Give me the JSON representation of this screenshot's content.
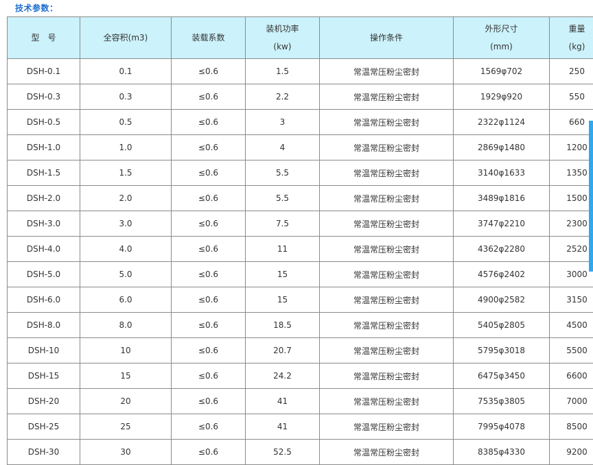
{
  "section_title": "技术参数：",
  "columns": [
    {
      "line1": "型　号",
      "line2": ""
    },
    {
      "line1": "全容积(m3)",
      "line2": ""
    },
    {
      "line1": "装载系数",
      "line2": ""
    },
    {
      "line1": "装机功率",
      "line2": "(kw)"
    },
    {
      "line1": "操作条件",
      "line2": ""
    },
    {
      "line1": "外形尺寸",
      "line2": "(mm)"
    },
    {
      "line1": "重量",
      "line2": "(kg)"
    }
  ],
  "rows": [
    [
      "DSH-0.1",
      "0.1",
      "≤0.6",
      "1.5",
      "常温常压粉尘密封",
      "1569φ702",
      "250"
    ],
    [
      "DSH-0.3",
      "0.3",
      "≤0.6",
      "2.2",
      "常温常压粉尘密封",
      "1929φ920",
      "550"
    ],
    [
      "DSH-0.5",
      "0.5",
      "≤0.6",
      "3",
      "常温常压粉尘密封",
      "2322φ1124",
      "660"
    ],
    [
      "DSH-1.0",
      "1.0",
      "≤0.6",
      "4",
      "常温常压粉尘密封",
      "2869φ1480",
      "1200"
    ],
    [
      "DSH-1.5",
      "1.5",
      "≤0.6",
      "5.5",
      "常温常压粉尘密封",
      "3140φ1633",
      "1350"
    ],
    [
      "DSH-2.0",
      "2.0",
      "≤0.6",
      "5.5",
      "常温常压粉尘密封",
      "3489φ1816",
      "1500"
    ],
    [
      "DSH-3.0",
      "3.0",
      "≤0.6",
      "7.5",
      "常温常压粉尘密封",
      "3747φ2210",
      "2300"
    ],
    [
      "DSH-4.0",
      "4.0",
      "≤0.6",
      "11",
      "常温常压粉尘密封",
      "4362φ2280",
      "2520"
    ],
    [
      "DSH-5.0",
      "5.0",
      "≤0.6",
      "15",
      "常温常压粉尘密封",
      "4576φ2402",
      "3000"
    ],
    [
      "DSH-6.0",
      "6.0",
      "≤0.6",
      "15",
      "常温常压粉尘密封",
      "4900φ2582",
      "3150"
    ],
    [
      "DSH-8.0",
      "8.0",
      "≤0.6",
      "18.5",
      "常温常压粉尘密封",
      "5405φ2805",
      "4500"
    ],
    [
      "DSH-10",
      "10",
      "≤0.6",
      "20.7",
      "常温常压粉尘密封",
      "5795φ3018",
      "5500"
    ],
    [
      "DSH-15",
      "15",
      "≤0.6",
      "24.2",
      "常温常压粉尘密封",
      "6475φ3450",
      "6600"
    ],
    [
      "DSH-20",
      "20",
      "≤0.6",
      "41",
      "常温常压粉尘密封",
      "7535φ3805",
      "7000"
    ],
    [
      "DSH-25",
      "25",
      "≤0.6",
      "41",
      "常温常压粉尘密封",
      "7995φ4078",
      "8500"
    ],
    [
      "DSH-30",
      "30",
      "≤0.6",
      "52.5",
      "常温常压粉尘密封",
      "8385φ4330",
      "9200"
    ]
  ],
  "colors": {
    "title": "#1f6fd0",
    "header_bg": "#ccf2fb",
    "border": "#8a8a8a",
    "scroll_indicator": "#2fa8f0"
  }
}
